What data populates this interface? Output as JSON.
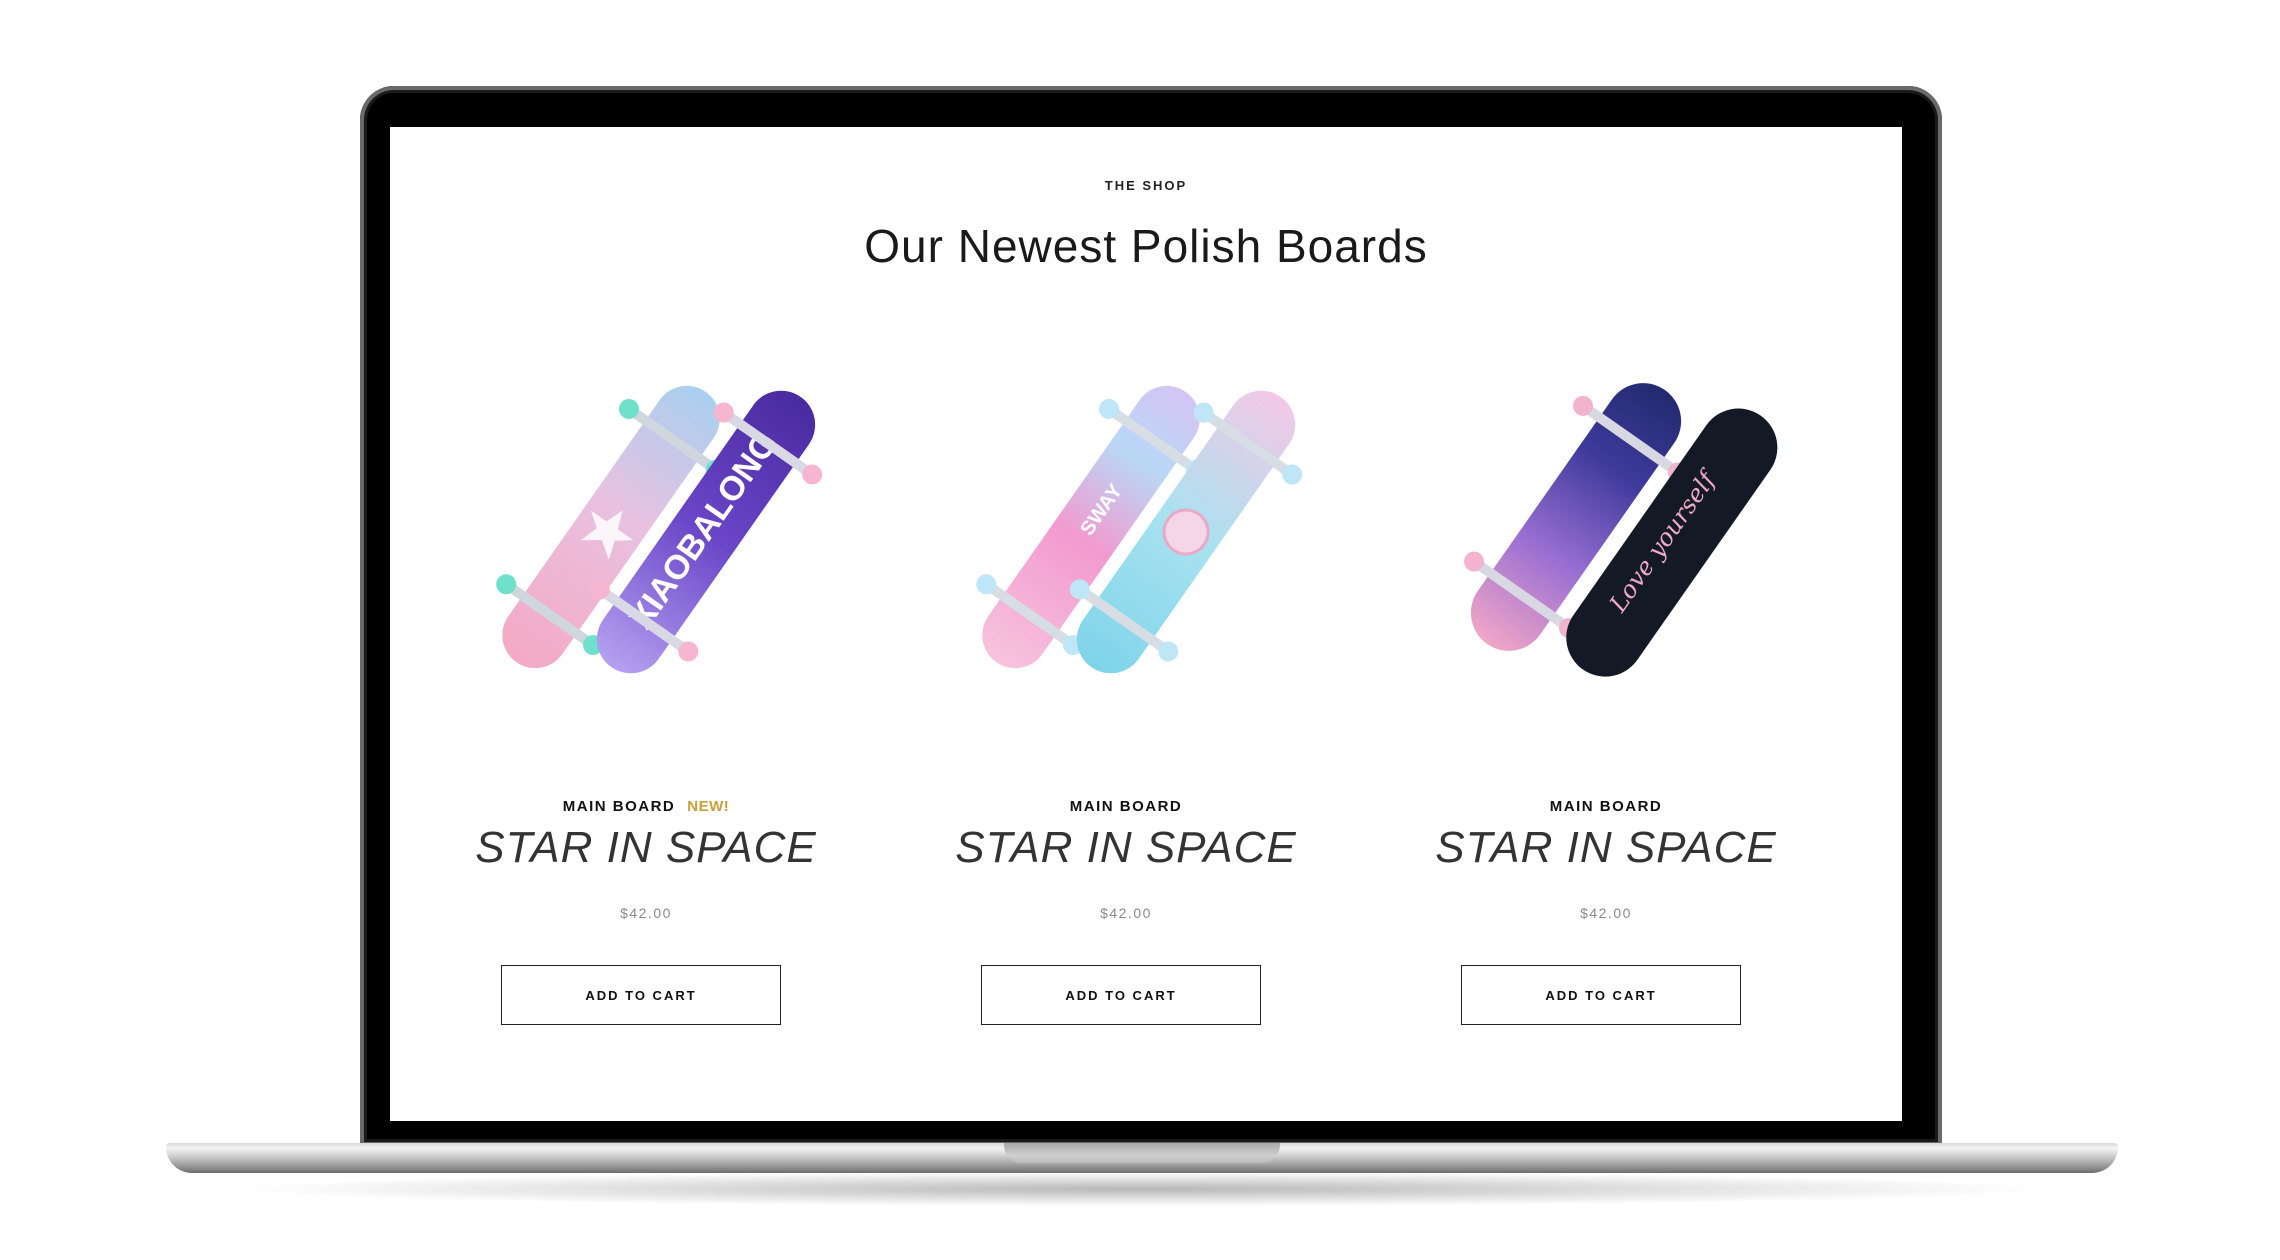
{
  "shop": {
    "eyebrow": "THE SHOP",
    "title": "Our Newest Polish Boards"
  },
  "products": [
    {
      "category": "MAIN BOARD",
      "badge": "NEW!",
      "name": "STAR IN SPACE",
      "price": "$42.00",
      "button": "ADD TO CART",
      "image_text": "XIAOBALONG",
      "image": "pink-and-purple-longboards"
    },
    {
      "category": "MAIN BOARD",
      "name": "STAR IN SPACE",
      "price": "$42.00",
      "button": "ADD TO CART",
      "image_text": "SWAY",
      "image": "pastel-holographic-longboards"
    },
    {
      "category": "MAIN BOARD",
      "name": "STAR IN SPACE",
      "price": "$42.00",
      "button": "ADD TO CART",
      "image_text": "Love yourself",
      "image": "galaxy-and-black-skateboards"
    }
  ],
  "colors": {
    "badge": "#c8a03a",
    "price": "#8a8a8a",
    "frame": "#000000"
  }
}
